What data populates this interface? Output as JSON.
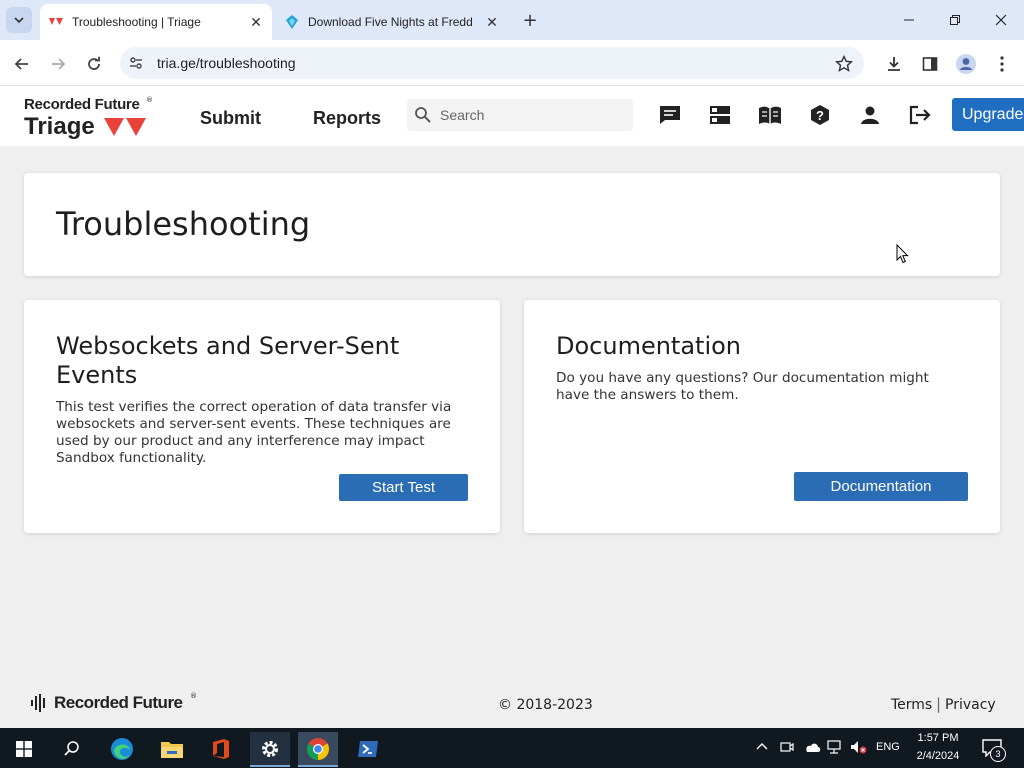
{
  "browser": {
    "tabs": [
      {
        "title": "Troubleshooting | Triage",
        "active": true
      },
      {
        "title": "Download Five Nights at Fredd",
        "active": false
      }
    ],
    "url": "tria.ge/troubleshooting"
  },
  "site": {
    "logo_line1": "Recorded Future",
    "logo_line2": "Triage",
    "nav": [
      "Submit",
      "Reports"
    ],
    "search_placeholder": "Search",
    "upgrade_label": "Upgrade",
    "brand_color": "#e8423a",
    "accent_color": "#1f6ec2"
  },
  "main": {
    "title": "Troubleshooting",
    "cards": [
      {
        "heading": "Websockets and Server-Sent Events",
        "body": "This test verifies the correct operation of data transfer via websockets and server-sent events. These techniques are used by our product and any interference may impact Sandbox functionality.",
        "button": "Start Test"
      },
      {
        "heading": "Documentation",
        "body": "Do you have any questions? Our documentation might have the answers to them.",
        "button": "Documentation"
      }
    ]
  },
  "footer": {
    "logo": "Recorded Future",
    "copyright": "© 2018-2023",
    "links": [
      "Terms",
      "Privacy"
    ],
    "separator": "|"
  },
  "taskbar": {
    "language": "ENG",
    "time": "1:57 PM",
    "date": "2/4/2024",
    "notifications": "3"
  }
}
